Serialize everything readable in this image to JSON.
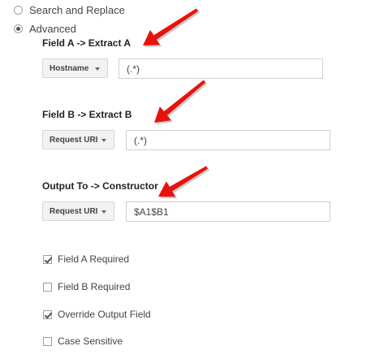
{
  "mode_options": [
    {
      "label": "Search and Replace",
      "checked": false
    },
    {
      "label": "Advanced",
      "checked": true
    }
  ],
  "field_a": {
    "heading": "Field A -> Extract A",
    "dropdown_label": "Hostname",
    "value": "(.*)"
  },
  "field_b": {
    "heading": "Field B -> Extract B",
    "dropdown_label": "Request URI",
    "value": "(.*)"
  },
  "output": {
    "heading": "Output To -> Constructor",
    "dropdown_label": "Request URI",
    "value": "$A1$B1"
  },
  "options": [
    {
      "label": "Field A Required",
      "checked": true
    },
    {
      "label": "Field B Required",
      "checked": false
    },
    {
      "label": "Override Output Field",
      "checked": true
    },
    {
      "label": "Case Sensitive",
      "checked": false
    }
  ],
  "icons": {
    "dropdown_caret": "caret-down-icon",
    "annotation": "red-arrow-icon"
  },
  "colors": {
    "arrow": "#e8120c",
    "arrow_shadow": "#8a8a8a",
    "dropdown_bg": "#f2f2f2",
    "input_border": "#cfcfcf"
  }
}
